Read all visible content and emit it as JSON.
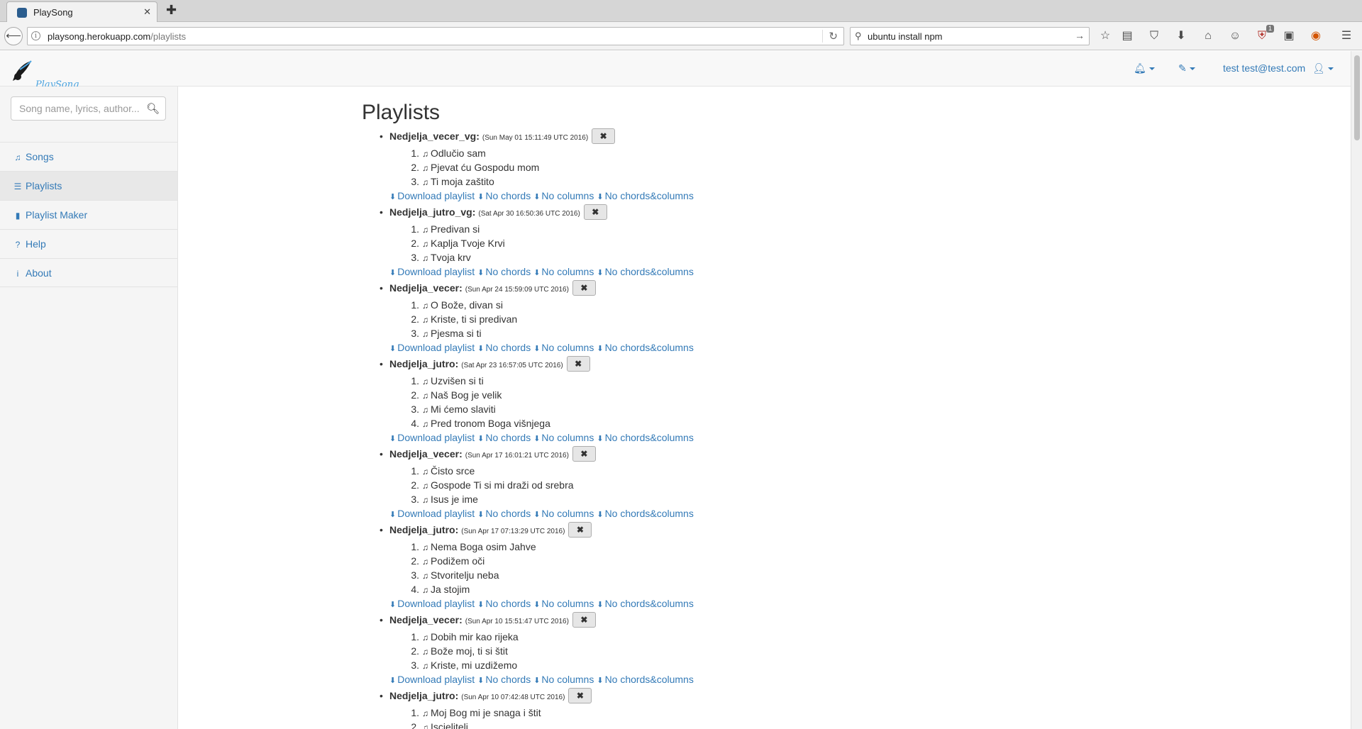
{
  "browser": {
    "tab_title": "PlaySong",
    "url_host": "playsong.herokuapp.com",
    "url_path": "/playlists",
    "search_value": "ubuntu install npm",
    "addon_badge": "1"
  },
  "app": {
    "logo_text": "PlaySong",
    "user_label": "test test@test.com"
  },
  "sidebar": {
    "search_placeholder": "Song name, lyrics, author...",
    "items": [
      {
        "label": "Songs",
        "icon": "music-note-icon"
      },
      {
        "label": "Playlists",
        "icon": "list-icon"
      },
      {
        "label": "Playlist Maker",
        "icon": "book-icon"
      },
      {
        "label": "Help",
        "icon": "question-circle-icon"
      },
      {
        "label": "About",
        "icon": "info-icon"
      }
    ]
  },
  "main": {
    "title": "Playlists",
    "download_labels": {
      "full": "Download playlist",
      "no_chords": "No chords",
      "no_columns": "No columns",
      "no_chords_columns": "No chords&columns"
    },
    "playlists": [
      {
        "name": "Nedjelja_vecer_vg:",
        "date": "(Sun May 01 15:11:49 UTC 2016)",
        "songs": [
          "Odlučio sam",
          "Pjevat ću Gospodu mom",
          "Ti moja zaštito"
        ]
      },
      {
        "name": "Nedjelja_jutro_vg:",
        "date": "(Sat Apr 30 16:50:36 UTC 2016)",
        "songs": [
          "Predivan si",
          "Kaplja Tvoje Krvi",
          "Tvoja krv"
        ]
      },
      {
        "name": "Nedjelja_vecer:",
        "date": "(Sun Apr 24 15:59:09 UTC 2016)",
        "songs": [
          "O Bože, divan si",
          "Kriste, ti si predivan",
          "Pjesma si ti"
        ]
      },
      {
        "name": "Nedjelja_jutro:",
        "date": "(Sat Apr 23 16:57:05 UTC 2016)",
        "songs": [
          "Uzvišen si ti",
          "Naš Bog je velik",
          "Mi ćemo slaviti",
          "Pred tronom Boga višnjega"
        ]
      },
      {
        "name": "Nedjelja_vecer:",
        "date": "(Sun Apr 17 16:01:21 UTC 2016)",
        "songs": [
          "Čisto srce",
          "Gospode Ti si mi draži od srebra",
          "Isus je ime"
        ]
      },
      {
        "name": "Nedjelja_jutro:",
        "date": "(Sun Apr 17 07:13:29 UTC 2016)",
        "songs": [
          "Nema Boga osim Jahve",
          "Podižem oči",
          "Stvoritelju neba",
          "Ja stojim"
        ]
      },
      {
        "name": "Nedjelja_vecer:",
        "date": "(Sun Apr 10 15:51:47 UTC 2016)",
        "songs": [
          "Dobih mir kao rijeka",
          "Bože moj, ti si štit",
          "Kriste, mi uzdižemo"
        ]
      },
      {
        "name": "Nedjelja_jutro:",
        "date": "(Sun Apr 10 07:42:48 UTC 2016)",
        "songs": [
          "Moj Bog mi je snaga i štit",
          "Iscjelitelj"
        ]
      }
    ]
  }
}
